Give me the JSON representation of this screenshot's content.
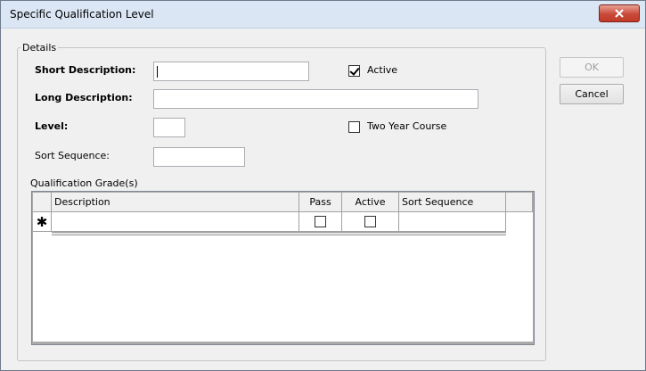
{
  "window": {
    "title": "Specific Qualification Level",
    "close_icon": "close-icon"
  },
  "details": {
    "legend": "Details",
    "short_description": {
      "label": "Short Description:",
      "value": ""
    },
    "long_description": {
      "label": "Long Description:",
      "value": ""
    },
    "level": {
      "label": "Level:",
      "value": ""
    },
    "sort_sequence": {
      "label": "Sort Sequence:",
      "value": ""
    },
    "active": {
      "label": "Active",
      "checked": true
    },
    "two_year_course": {
      "label": "Two Year Course",
      "checked": false
    }
  },
  "grades": {
    "label": "Qualification Grade(s)",
    "columns": [
      "Description",
      "Pass",
      "Active",
      "Sort Sequence"
    ],
    "new_row_marker": "✱",
    "new_row": {
      "description": "",
      "pass": false,
      "active": false,
      "sort_sequence": ""
    }
  },
  "buttons": {
    "ok": "OK",
    "cancel": "Cancel"
  }
}
